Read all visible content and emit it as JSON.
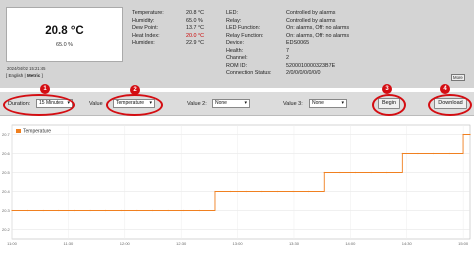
{
  "device_card": {
    "temperature": "20.8 °C",
    "humidity": "65.0 %",
    "timestamp": "2024/04/02 15:21:45",
    "units": {
      "english": "English",
      "separator": "|",
      "metric": "Metric"
    }
  },
  "sensor": {
    "temperature_label": "Temperature:",
    "temperature_value": "20.8 °C",
    "humidity_label": "Humidity:",
    "humidity_value": "65.0 %",
    "dewpoint_label": "Dew Point:",
    "dewpoint_value": "13.7 °C",
    "heatindex_label": "Heat Index:",
    "heatindex_value": "20.0 °C",
    "humidex_label": "Humidex:",
    "humidex_value": "22.9 °C"
  },
  "device": {
    "led_label": "LED:",
    "led_value": "Controlled by alarms",
    "relay_label": "Relay:",
    "relay_value": "Controlled by alarms",
    "ledfn_label": "LED Function:",
    "ledfn_value": "On: alarms, Off: no alarms",
    "relayfn_label": "Relay Function:",
    "relayfn_value": "On: alarms, Off: no alarms",
    "device_label": "Device:",
    "device_value": "EDS0065",
    "health_label": "Health:",
    "health_value": "7",
    "channel_label": "Channel:",
    "channel_value": "2",
    "romid_label": "ROM ID:",
    "romid_value": "5200010000323B7E",
    "conn_label": "Connection Status:",
    "conn_value": "2/0/0/0/0/0/0/0"
  },
  "more_label": "More",
  "controls": {
    "duration_label": "Duration:",
    "duration_value": "15 Minutes",
    "value_label": "Value",
    "value_value": "Temperature",
    "value2_label": "Value 2:",
    "value2_value": "None",
    "value3_label": "Value 3:",
    "value3_value": "None",
    "begin_label": "Begin",
    "download_label": "Download",
    "caret": "▾"
  },
  "annotations": [
    "1",
    "2",
    "3",
    "4"
  ],
  "colors": {
    "annotation": "#d40d12",
    "series": "#f08020",
    "highlight": "#cc0000"
  },
  "chart_data": {
    "type": "line",
    "legend": [
      "Temperature"
    ],
    "legend_position": "top-left",
    "xlabels": [
      "11:00",
      "11:30",
      "12:00",
      "12:30",
      "13:00",
      "13:30",
      "14:00",
      "14:30",
      "15:00"
    ],
    "ylabels": [
      "20.7",
      "20.6",
      "20.5",
      "20.4",
      "20.3",
      "20.2"
    ],
    "ylim": [
      20.15,
      20.75
    ],
    "xlim": [
      0,
      264
    ],
    "grid": true,
    "series": [
      {
        "name": "Temperature",
        "x": [
          0,
          9,
          18,
          27,
          36,
          45,
          54,
          63,
          72,
          81,
          90,
          99,
          108,
          117,
          126,
          135,
          144,
          153,
          162,
          171,
          180,
          189,
          198,
          207,
          216,
          225,
          234,
          243,
          252,
          260,
          264
        ],
        "y": [
          20.3,
          20.3,
          20.3,
          20.3,
          20.3,
          20.3,
          20.3,
          20.3,
          20.3,
          20.3,
          20.3,
          20.3,
          20.3,
          20.4,
          20.4,
          20.4,
          20.4,
          20.4,
          20.4,
          20.4,
          20.5,
          20.5,
          20.5,
          20.5,
          20.5,
          20.6,
          20.6,
          20.6,
          20.6,
          20.7,
          20.7
        ]
      }
    ]
  }
}
